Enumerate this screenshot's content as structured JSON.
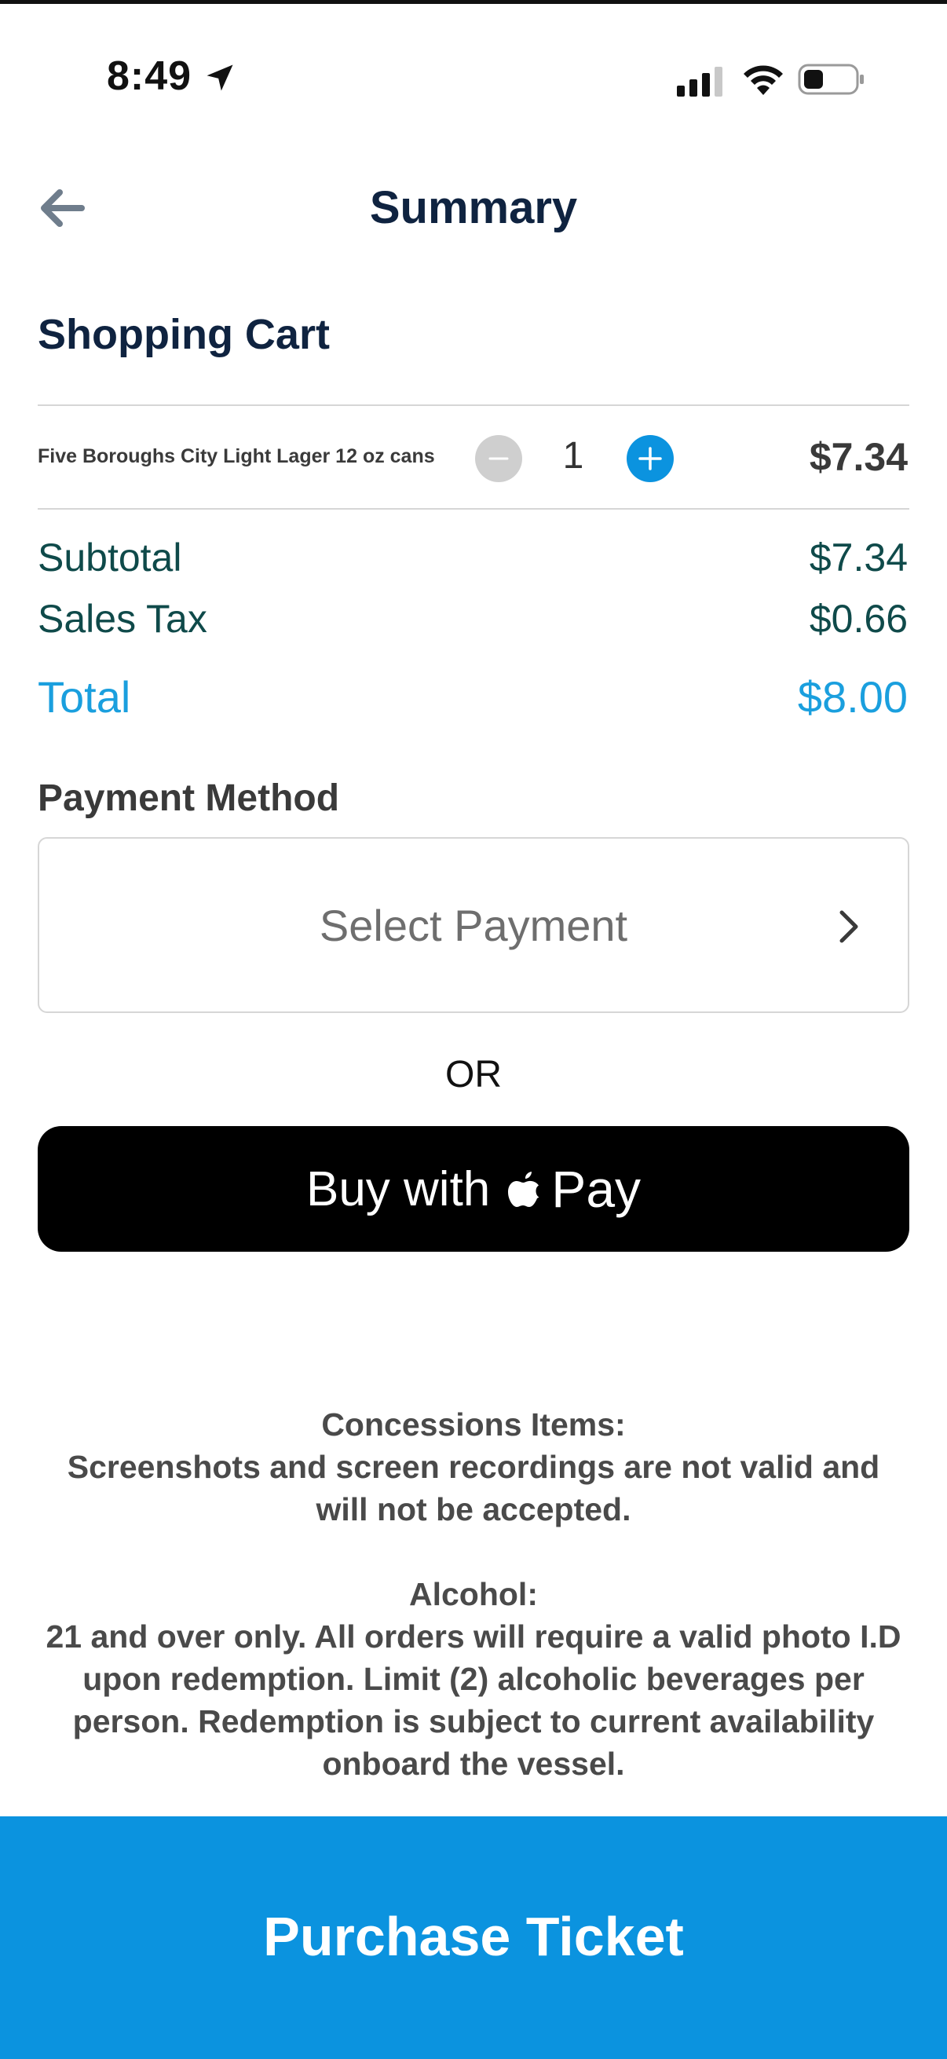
{
  "status_bar": {
    "time": "8:49"
  },
  "header": {
    "title": "Summary"
  },
  "cart": {
    "title": "Shopping Cart",
    "items": [
      {
        "name": "Five Boroughs City Light Lager 12 oz cans",
        "quantity": "1",
        "price": "$7.34"
      }
    ]
  },
  "summary": {
    "subtotal_label": "Subtotal",
    "subtotal_value": "$7.34",
    "tax_label": "Sales Tax",
    "tax_value": "$0.66",
    "total_label": "Total",
    "total_value": "$8.00"
  },
  "payment": {
    "heading": "Payment Method",
    "select_label": "Select Payment",
    "or_text": "OR",
    "apple_pay_prefix": "Buy with",
    "apple_pay_word": "Pay"
  },
  "notices": {
    "concessions_title": "Concessions Items:",
    "concessions_body": "Screenshots and screen recordings are not valid and will not be accepted.",
    "alcohol_title": "Alcohol:",
    "alcohol_body": "21 and over only. All orders will require a valid photo I.D upon redemption. Limit (2) alcoholic beverages per person. Redemption is subject to current availability onboard the vessel."
  },
  "footer": {
    "purchase_label": "Purchase Ticket"
  },
  "colors": {
    "navy": "#0f2340",
    "accent_blue": "#0b93df",
    "total_blue": "#1a9fde",
    "teal_text": "#0f4a4a"
  }
}
